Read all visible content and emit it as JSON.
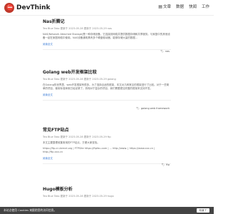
{
  "header": {
    "brand": "DevThink",
    "nav": [
      {
        "icon": "document-icon",
        "label": "文章"
      },
      {
        "icon": "",
        "label": "数据"
      },
      {
        "icon": "",
        "label": "快闻"
      },
      {
        "icon": "",
        "label": "工作"
      }
    ]
  },
  "posts": [
    {
      "title": "Nas折腾记",
      "meta": "Tea Blue  Tako  更新于 2023-05-28 更新于 2023-05-29  nas",
      "excerpt": "NAS(Network Attached Storage)是一种存储设备，它连接到网络并提供数据存储和共享服务。与家庭中的其他设备一起在家庭网络中使用。NAS设备通常具有多个硬盘驱动器，能够存储大量的数据...",
      "read_more": "阅读全文",
      "tag": "nas"
    },
    {
      "title": "Golang web开发框架比较",
      "meta": "Tea Blue  Tako  更新于 2023-05-28 更新于 2023-05-29  golang",
      "excerpt": "在Golang的世界里，web开发框架有很多。为了选择合适的框架，本文对几种常见的框架进行了比较。对于一些简单的项目，使用标准库就已经足够了。然而对于复杂的项目，我们需要更加完善的框架来支持开发。",
      "read_more": "阅读全文",
      "tag": "golang web framework"
    },
    {
      "title": "常见FTP站点",
      "meta": "Tea Blue  Tako  更新于 2023-05-28 更新于 2023-05-29  ftp",
      "excerpt": "本文主要整理收集常用的FTP站点，方便大家查找。",
      "links": "https://ftp.cn.kernel.org  |  FTPSite https://ftpfau.com  |  ...  http://www.  |  https://www.xxx.cn  |  http://ftp.xxx.cn",
      "read_more": "阅读全文",
      "tag": "ftp"
    },
    {
      "title": "Hugo模板分析",
      "meta": "Tea Blue  Tako  更新于 2023-05-28 更新于 2023-05-29  hugo",
      "excerpt": "",
      "read_more": "",
      "tag": ""
    }
  ],
  "cookie": {
    "text": "本站点使用 Cookies 来跟踪您的访问信息。",
    "button": "知道了"
  },
  "colors": {
    "logo": "#c0392b",
    "link": "#3a7bd5",
    "cookie_bg": "#444444"
  }
}
